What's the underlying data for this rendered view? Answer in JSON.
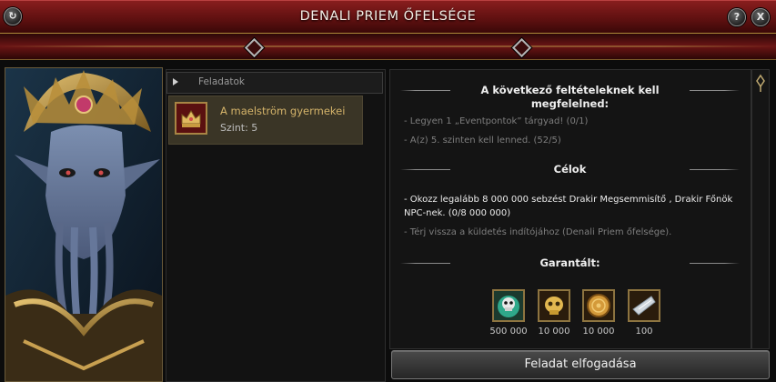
{
  "window": {
    "title": "DENALI PRIEM ŐFELSÉGE",
    "refresh_icon": "↻",
    "help_label": "?",
    "close_label": "X"
  },
  "quest_list": {
    "header": "Feladatok",
    "items": [
      {
        "name": "A maelström gyermekei",
        "level": "Szint: 5"
      }
    ]
  },
  "details": {
    "requirements_title_line1": "A következő feltételeknek kell",
    "requirements_title_line2": "megfelelned:",
    "requirements": [
      "- Legyen 1 „Eventpontok” tárgyad! (0/1)",
      "- A(z) 5. szinten kell lenned. (52/5)"
    ],
    "goals_title": "Célok",
    "goals": [
      {
        "line1": "- Okozz legalább 8 000 000 sebzést Drakir Megsemmisítő , Drakir Főnök",
        "line2": "NPC-nek. (0/8 000 000)"
      },
      {
        "line1": "- Térj vissza a küldetés indítójához (Denali Priem őfelsége).",
        "line2": ""
      }
    ],
    "rewards_title": "Garantált:",
    "rewards": [
      {
        "icon": "skull-orb-icon",
        "amount": "500 000"
      },
      {
        "icon": "golden-skull-icon",
        "amount": "10 000"
      },
      {
        "icon": "gold-coin-icon",
        "amount": "10 000"
      },
      {
        "icon": "crystal-shard-icon",
        "amount": "100"
      }
    ]
  },
  "accept_button": "Feladat elfogadása",
  "colors": {
    "title_red": "#8a1e1e",
    "quest_name_gold": "#d5b46a",
    "frame_gold": "#8d7440"
  }
}
